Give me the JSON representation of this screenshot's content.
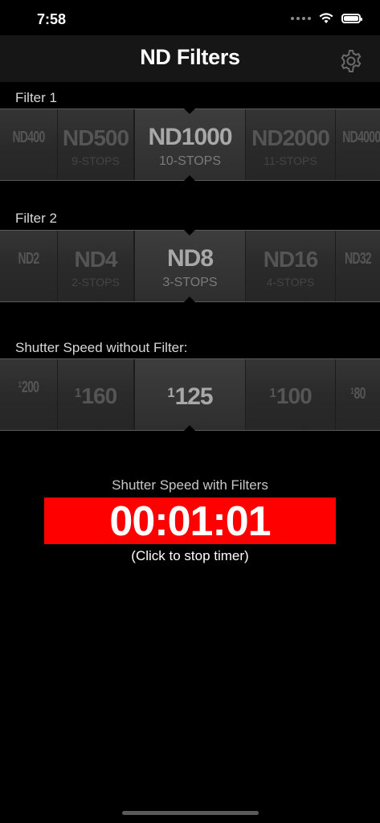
{
  "status": {
    "time": "7:58"
  },
  "nav": {
    "title": "ND Filters"
  },
  "filter1": {
    "label": "Filter 1",
    "items": [
      {
        "main": "ND400",
        "sub": ""
      },
      {
        "main": "ND500",
        "sub": "9-STOPS"
      },
      {
        "main": "ND1000",
        "sub": "10-STOPS"
      },
      {
        "main": "ND2000",
        "sub": "11-STOPS"
      },
      {
        "main": "ND4000",
        "sub": ""
      }
    ]
  },
  "filter2": {
    "label": "Filter 2",
    "items": [
      {
        "main": "ND2",
        "sub": ""
      },
      {
        "main": "ND4",
        "sub": "2-STOPS"
      },
      {
        "main": "ND8",
        "sub": "3-STOPS"
      },
      {
        "main": "ND16",
        "sub": "4-STOPS"
      },
      {
        "main": "ND32",
        "sub": ""
      }
    ]
  },
  "shutter": {
    "label": "Shutter Speed without Filter:",
    "items": [
      {
        "num": "1",
        "den": "200"
      },
      {
        "num": "1",
        "den": "160"
      },
      {
        "num": "1",
        "den": "125"
      },
      {
        "num": "1",
        "den": "100"
      },
      {
        "num": "1",
        "den": "80"
      }
    ]
  },
  "result": {
    "label": "Shutter Speed with Filters",
    "timer": "00:01:01",
    "hint": "(Click to stop timer)"
  },
  "colors": {
    "timer_bg": "#ff0000",
    "background": "#000000",
    "nav_bg": "#161616"
  }
}
